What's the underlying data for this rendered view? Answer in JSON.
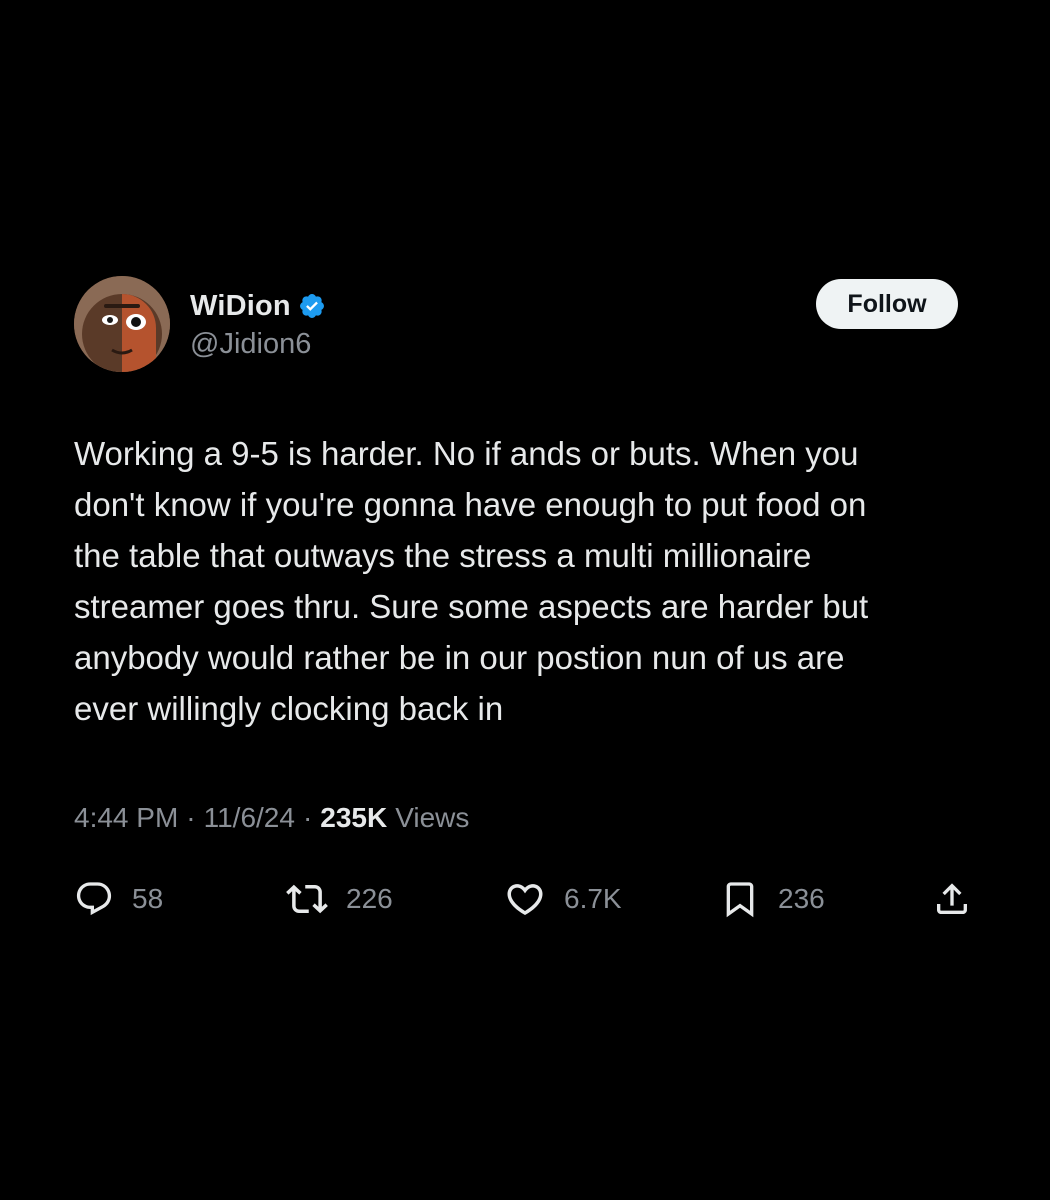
{
  "author": {
    "display_name": "WiDion",
    "handle": "@Jidion6",
    "verified": true
  },
  "follow_label": "Follow",
  "tweet": {
    "lines": [
      "Working a 9-5 is harder. No if ands or buts. When you",
      "don't know if you're gonna have enough to put food on",
      "the table that outways the stress a multi millionaire",
      "streamer goes thru. Sure some aspects are harder but",
      "anybody would rather be in our postion nun of us are",
      "ever willingly clocking back in"
    ],
    "time": "4:44 PM",
    "separator": "·",
    "date": "11/6/24",
    "views_count": "235K",
    "views_label": "Views"
  },
  "actions": {
    "replies": "58",
    "reposts": "226",
    "likes": "6.7K",
    "bookmarks": "236"
  },
  "colors": {
    "background": "#000000",
    "text": "#e7e9ea",
    "secondary": "#8b9097",
    "verified": "#1d9bf0",
    "follow_bg": "#eff3f4"
  }
}
